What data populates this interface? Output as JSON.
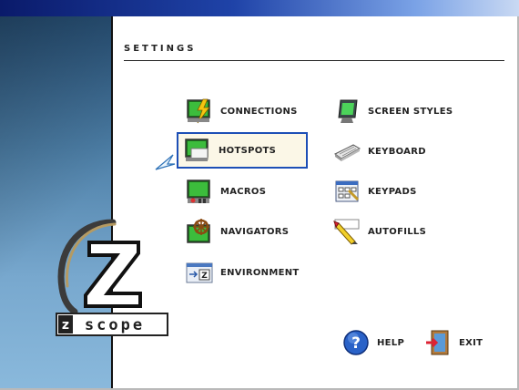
{
  "header": {
    "section_title": "SETTINGS"
  },
  "menu": {
    "left": [
      {
        "label": "CONNECTIONS",
        "icon": "connections-icon"
      },
      {
        "label": "HOTSPOTS",
        "icon": "hotspots-icon",
        "selected": true
      },
      {
        "label": "MACROS",
        "icon": "macros-icon"
      },
      {
        "label": "NAVIGATORS",
        "icon": "navigators-icon"
      },
      {
        "label": "ENVIRONMENT",
        "icon": "environment-icon"
      }
    ],
    "right": [
      {
        "label": "SCREEN STYLES",
        "icon": "screen-styles-icon"
      },
      {
        "label": "KEYBOARD",
        "icon": "keyboard-icon"
      },
      {
        "label": "KEYPADS",
        "icon": "keypads-icon"
      },
      {
        "label": "AUTOFILLS",
        "icon": "autofills-icon"
      }
    ]
  },
  "footer": {
    "help_label": "HELP",
    "exit_label": "EXIT"
  },
  "logo": {
    "text": "zscope"
  },
  "colors": {
    "accent": "#1d4fb6",
    "selected_bg": "#fbf7e7",
    "title_bar": "#0a1a6a"
  }
}
